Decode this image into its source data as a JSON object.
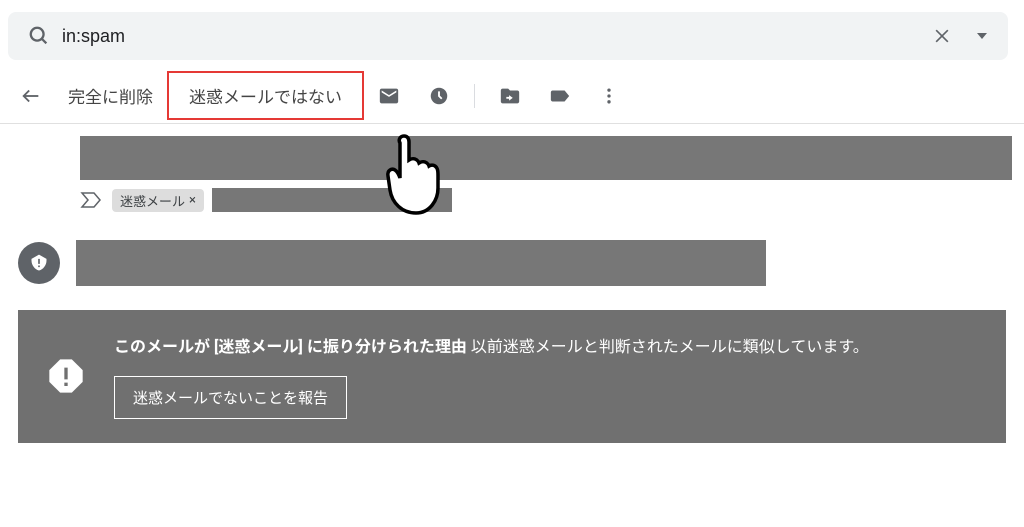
{
  "search": {
    "value": "in:spam"
  },
  "toolbar": {
    "delete_forever": "完全に削除",
    "not_spam": "迷惑メールではない"
  },
  "labels": {
    "spam_chip": "迷惑メール"
  },
  "spam_banner": {
    "title_bold": "このメールが [迷惑メール] に振り分けられた理由",
    "title_rest": " 以前迷惑メールと判断されたメールに類似しています。",
    "report_button": "迷惑メールでないことを報告"
  }
}
